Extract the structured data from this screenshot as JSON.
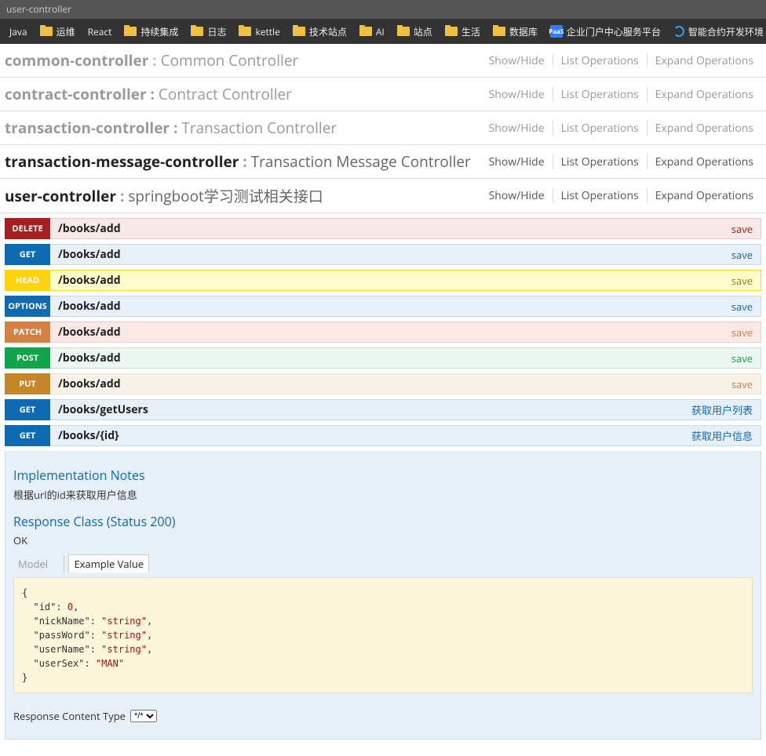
{
  "titlebar": "user-controller",
  "bookmarks": [
    {
      "type": "text",
      "label": "Java"
    },
    {
      "type": "folder",
      "label": "运维"
    },
    {
      "type": "text",
      "label": "React"
    },
    {
      "type": "folder",
      "label": "持续集成"
    },
    {
      "type": "folder",
      "label": "日志"
    },
    {
      "type": "folder",
      "label": "kettle"
    },
    {
      "type": "folder",
      "label": "技术站点"
    },
    {
      "type": "folder",
      "label": "AI"
    },
    {
      "type": "folder",
      "label": "站点"
    },
    {
      "type": "folder",
      "label": "生活"
    },
    {
      "type": "folder",
      "label": "数据库"
    },
    {
      "type": "paas",
      "label": "企业门户中心服务平台"
    },
    {
      "type": "blue",
      "label": "智能合约开发环境"
    }
  ],
  "controllers": [
    {
      "name": "common-controller",
      "sep": " : ",
      "desc": "Common Controller",
      "active": false,
      "faded": true
    },
    {
      "name": "contract-controller",
      "sep": " : ",
      "desc": "Contract Controller",
      "active": false,
      "faded": false
    },
    {
      "name": "transaction-controller",
      "sep": " : ",
      "desc": "Transaction Controller",
      "active": false,
      "faded": false
    },
    {
      "name": "transaction-message-controller",
      "sep": " : ",
      "desc": "Transaction Message Controller",
      "active": true,
      "faded": false
    },
    {
      "name": "user-controller",
      "sep": " : ",
      "desc": "springboot学习测试相关接口",
      "active": true,
      "faded": false
    }
  ],
  "ops": {
    "showhide": "Show/Hide",
    "list": "List Operations",
    "expand": "Expand Operations"
  },
  "endpoints": [
    {
      "method": "DELETE",
      "cls": "delete",
      "path": "/books/add",
      "desc": "save"
    },
    {
      "method": "GET",
      "cls": "get",
      "path": "/books/add",
      "desc": "save"
    },
    {
      "method": "HEAD",
      "cls": "head",
      "path": "/books/add",
      "desc": "save"
    },
    {
      "method": "OPTIONS",
      "cls": "options",
      "path": "/books/add",
      "desc": "save"
    },
    {
      "method": "PATCH",
      "cls": "patch",
      "path": "/books/add",
      "desc": "save"
    },
    {
      "method": "POST",
      "cls": "post",
      "path": "/books/add",
      "desc": "save"
    },
    {
      "method": "PUT",
      "cls": "put",
      "path": "/books/add",
      "desc": "save"
    },
    {
      "method": "GET",
      "cls": "get",
      "path": "/books/getUsers",
      "desc": "获取用户列表"
    },
    {
      "method": "GET",
      "cls": "get",
      "path": "/books/{id}",
      "desc": "获取用户信息"
    }
  ],
  "detail": {
    "impl_h": "Implementation Notes",
    "impl_note": "根据url的id来获取用户信息",
    "resp_h": "Response Class (Status 200)",
    "ok": "OK",
    "tab_model": "Model",
    "tab_example": "Example Value",
    "json_lines": [
      "{",
      "  \"id\": 0,",
      "  \"nickName\": \"string\",",
      "  \"passWord\": \"string\",",
      "  \"userName\": \"string\",",
      "  \"userSex\": \"MAN\"",
      "}"
    ],
    "resp_type_label": "Response Content Type",
    "resp_type_value": "*/*"
  }
}
